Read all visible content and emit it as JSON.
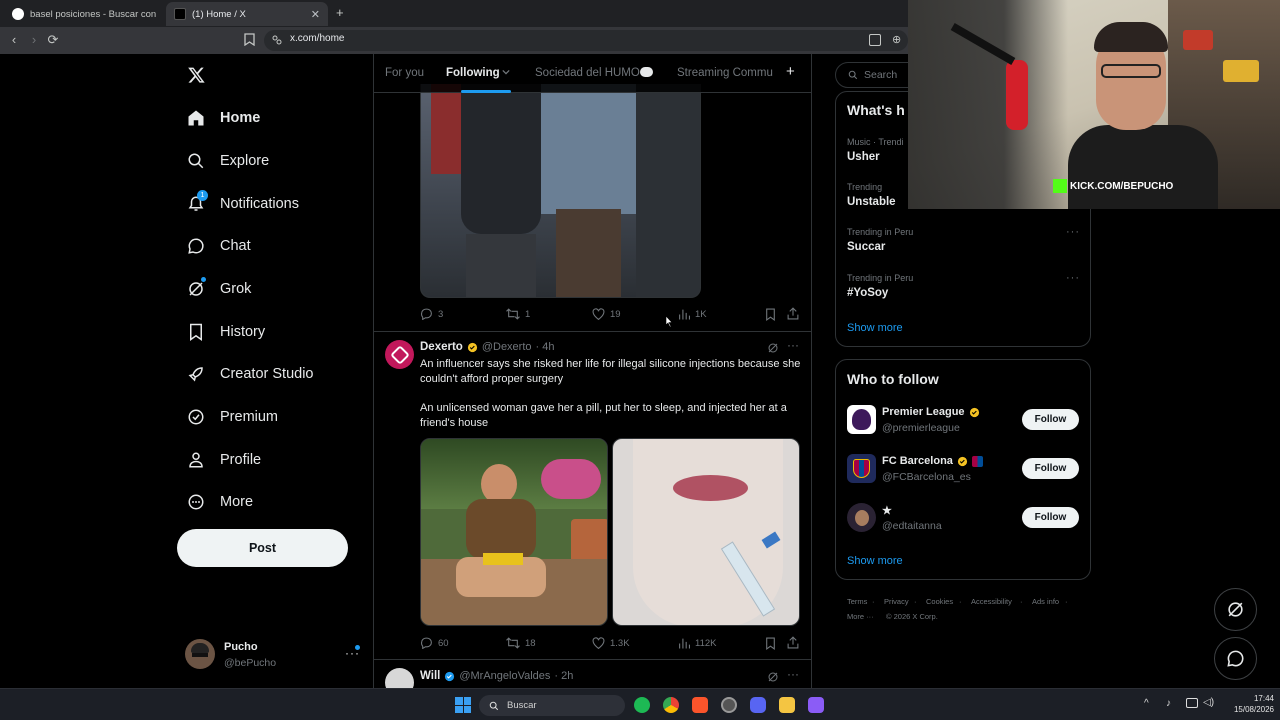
{
  "browser": {
    "tabs": [
      {
        "title": "basel posiciones - Buscar con Google",
        "active": false
      },
      {
        "title": "(1) Home / X",
        "active": true
      }
    ],
    "new_tab": "+",
    "url": "x.com/home"
  },
  "sidebar": {
    "items": [
      {
        "label": "Home",
        "icon": "home-icon"
      },
      {
        "label": "Explore",
        "icon": "search-icon"
      },
      {
        "label": "Notifications",
        "icon": "bell-icon",
        "badge": "1"
      },
      {
        "label": "Chat",
        "icon": "chat-icon"
      },
      {
        "label": "Grok",
        "icon": "grok-icon"
      },
      {
        "label": "History",
        "icon": "bookmark-icon"
      },
      {
        "label": "Creator Studio",
        "icon": "rocket-icon"
      },
      {
        "label": "Premium",
        "icon": "verified-icon"
      },
      {
        "label": "Profile",
        "icon": "person-icon"
      },
      {
        "label": "More",
        "icon": "more-circle-icon"
      }
    ],
    "post_label": "Post",
    "account": {
      "name": "Pucho",
      "handle": "@bePucho"
    }
  },
  "feed": {
    "tabs": [
      "For you",
      "Following",
      "Sociedad del HUMO",
      "Streaming Commu"
    ],
    "add_tab": "+",
    "tweet0": {
      "replies": "3",
      "retweets": "1",
      "likes": "19",
      "views": "1K"
    },
    "tweet1": {
      "name": "Dexerto",
      "handle": "@Dexerto",
      "time": "· 4h",
      "text1": "An influencer says she risked her life for illegal silicone injections because she couldn't afford proper surgery",
      "text2": "An unlicensed woman gave her a pill, put her to sleep, and injected her at a friend's house",
      "replies": "60",
      "retweets": "18",
      "likes": "1.3K",
      "views": "112K"
    },
    "tweet2": {
      "name": "Will",
      "handle": "@MrAngeloValdes",
      "time": "· 2h"
    }
  },
  "right": {
    "search_placeholder": "Search",
    "trending_title": "What's h",
    "trends": [
      {
        "meta": "Music · Trendi",
        "name": "Usher"
      },
      {
        "meta": "Trending",
        "name": "Unstable"
      },
      {
        "meta": "Trending in Peru",
        "name": "Succar"
      },
      {
        "meta": "Trending in Peru",
        "name": "#YoSoy"
      }
    ],
    "show_more": "Show more",
    "wtf_title": "Who to follow",
    "wtf": [
      {
        "name": "Premier League",
        "handle": "@premierleague"
      },
      {
        "name": "FC Barcelona",
        "handle": "@FCBarcelona_es"
      },
      {
        "name": "★",
        "handle": "@edtaitanna"
      }
    ],
    "follow_label": "Follow",
    "footer": [
      "Terms",
      "Privacy",
      "Cookies",
      "Accessibility",
      "Ads info",
      "More ···",
      "© 2026 X Corp."
    ]
  },
  "webcam": {
    "overlay_text": "KICK.COM/BEPUCHO"
  },
  "taskbar": {
    "search_label": "Buscar",
    "time": "17:44",
    "date": "15/08/2026"
  },
  "colors": {
    "accent": "#1d9bf0",
    "background": "#000000",
    "muted": "#71767b",
    "verified": "#f4c223",
    "kick": "#53fc18"
  }
}
